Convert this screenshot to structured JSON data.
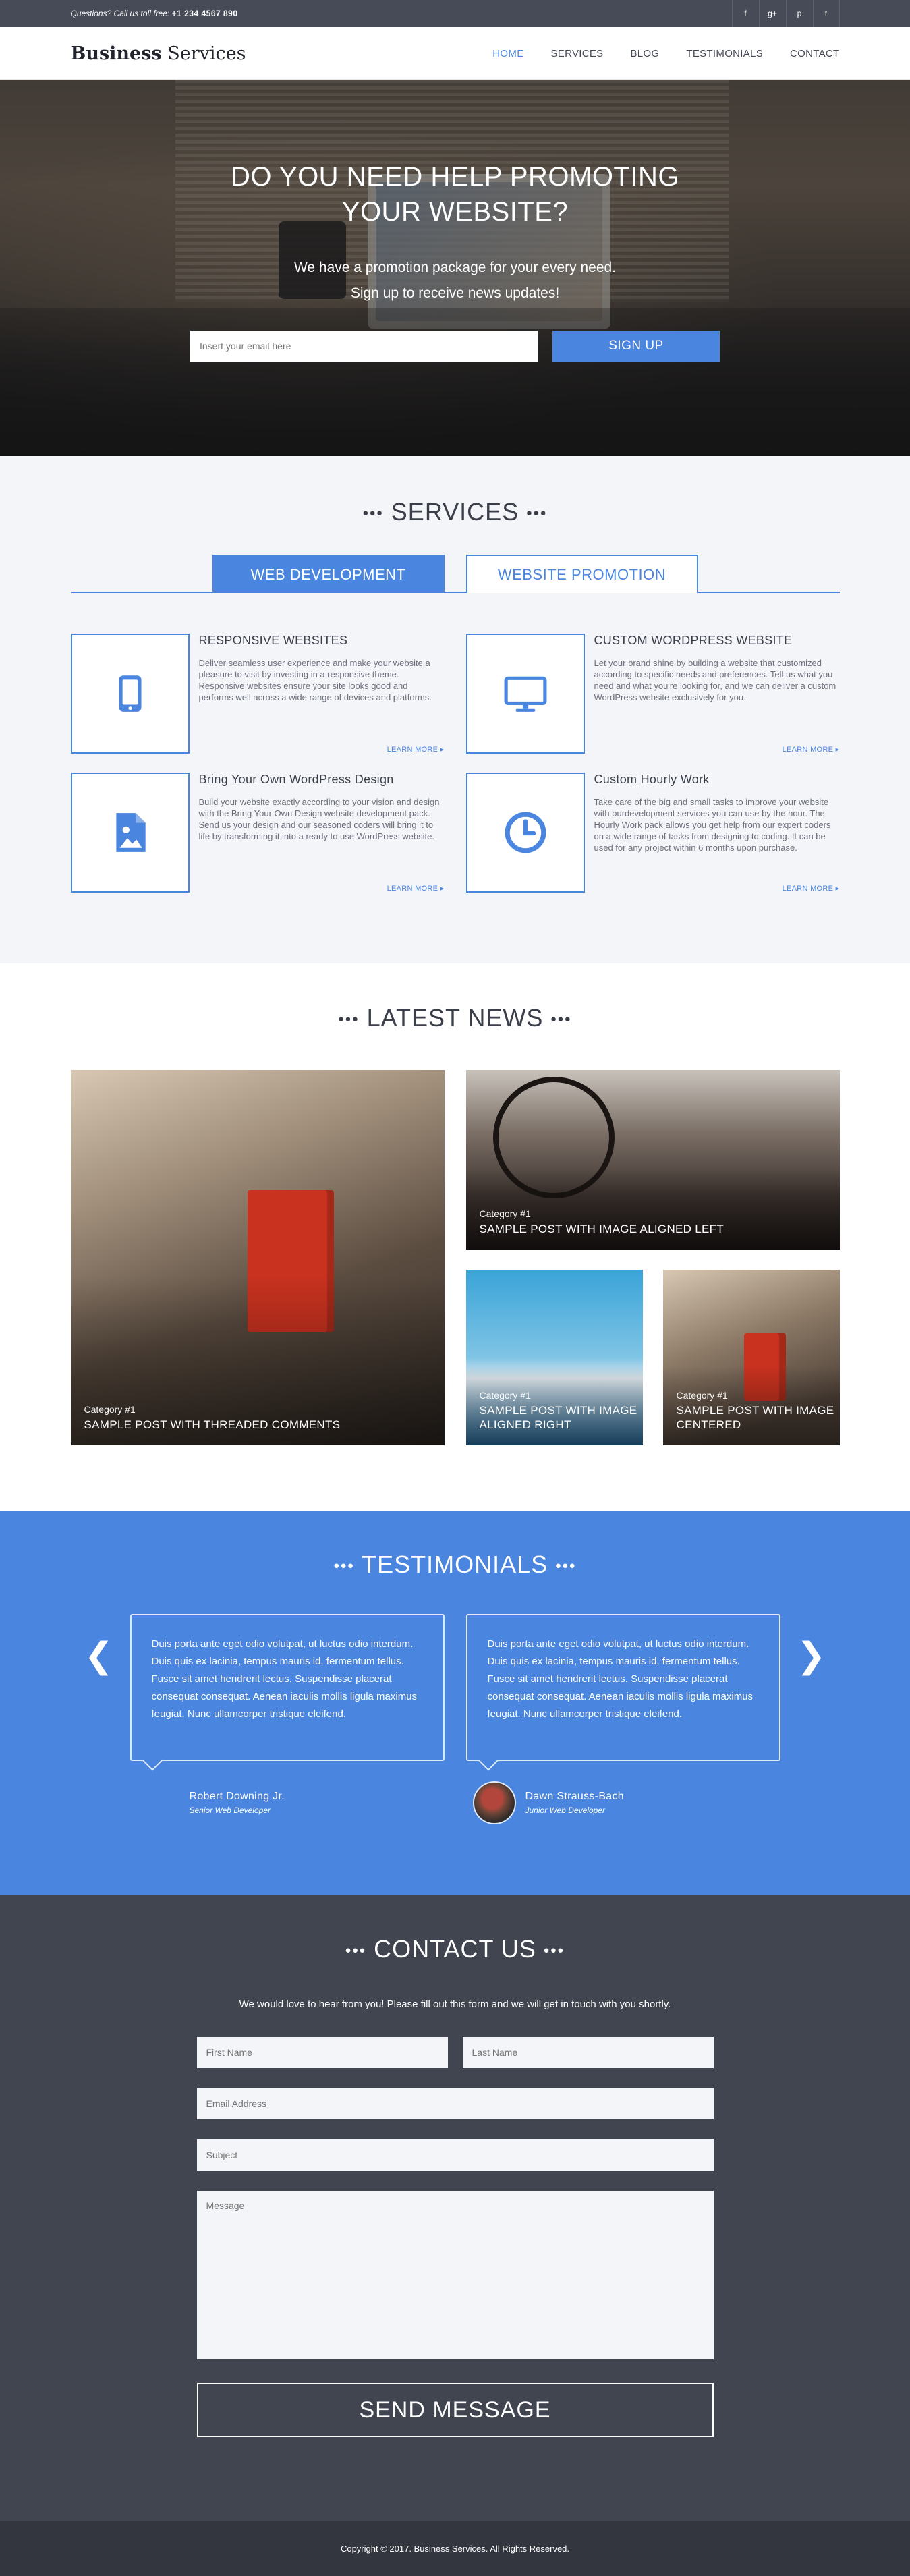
{
  "topbar": {
    "phone_label": "Questions? Call us toll free:",
    "phone_number": "+1 234 4567 890",
    "social": [
      "f",
      "g+",
      "p",
      "t"
    ]
  },
  "nav": {
    "logo_bold": "Business",
    "logo_rest": "Services",
    "items": [
      "HOME",
      "SERVICES",
      "BLOG",
      "TESTIMONIALS",
      "CONTACT"
    ]
  },
  "hero": {
    "title_line1": "DO YOU NEED HELP PROMOTING",
    "title_line2": "YOUR WEBSITE?",
    "sub_line1": "We have a promotion package for your every need.",
    "sub_line2": "Sign up to receive news updates!",
    "email_placeholder": "Insert your email here",
    "signup_label": "SIGN UP"
  },
  "services": {
    "title": "SERVICES",
    "tabs": [
      "WEB DEVELOPMENT",
      "WEBSITE PROMOTION"
    ],
    "items": [
      {
        "icon": "tablet-icon",
        "title": "RESPONSIVE WEBSITES",
        "text": "Deliver seamless user experience and make your website a pleasure to visit by investing in a responsive theme. Responsive websites ensure your site looks good and performs well across a wide range of devices and platforms.",
        "more": "LEARN MORE"
      },
      {
        "icon": "monitor-icon",
        "title": "CUSTOM WORDPRESS WEBSITE",
        "text": "Let your brand shine by building a website that customized according to specific needs and preferences. Tell us what you need and what you're looking for, and we can deliver a custom WordPress website exclusively for you.",
        "more": "LEARN MORE"
      },
      {
        "icon": "image-file-icon",
        "title": "Bring Your Own WordPress Design",
        "text": "Build your website exactly according to your vision and design with the Bring Your Own Design website development pack. Send us your design and our seasoned coders will bring it to life by transforming it into a ready to use WordPress website.",
        "more": "LEARN MORE"
      },
      {
        "icon": "clock-icon",
        "title": "Custom Hourly Work",
        "text": "Take care of the big and small tasks to improve your website with ourdevelopment services you can use by the hour. The Hourly Work pack allows you get help from our expert coders on a wide range of tasks from designing to coding. It can be used for any project within 6 months upon purchase.",
        "more": "LEARN MORE"
      }
    ]
  },
  "news": {
    "title": "LATEST NEWS",
    "posts": [
      {
        "category": "Category #1",
        "title": "SAMPLE POST WITH THREADED COMMENTS"
      },
      {
        "category": "Category #1",
        "title": "SAMPLE POST WITH IMAGE ALIGNED LEFT"
      },
      {
        "category": "Category #1",
        "title": "SAMPLE POST WITH IMAGE ALIGNED RIGHT"
      },
      {
        "category": "Category #1",
        "title": "SAMPLE POST WITH IMAGE CENTERED"
      }
    ]
  },
  "testimonials": {
    "title": "TESTIMONIALS",
    "items": [
      {
        "quote": "Duis porta ante eget odio volutpat, ut luctus odio interdum. Duis quis ex lacinia, tempus mauris id, fermentum tellus. Fusce sit amet hendrerit lectus. Suspendisse placerat consequat consequat. Aenean iaculis mollis ligula maximus feugiat. Nunc ullamcorper tristique eleifend.",
        "name": "Robert Downing Jr.",
        "role": "Senior Web Developer"
      },
      {
        "quote": "Duis porta ante eget odio volutpat, ut luctus odio interdum. Duis quis ex lacinia, tempus mauris id, fermentum tellus. Fusce sit amet hendrerit lectus. Suspendisse placerat consequat consequat. Aenean iaculis mollis ligula maximus feugiat. Nunc ullamcorper tristique eleifend.",
        "name": "Dawn Strauss-Bach",
        "role": "Junior Web Developer"
      }
    ]
  },
  "contact": {
    "title": "CONTACT US",
    "intro": "We would love to hear from you! Please fill out this form and we will get in touch with you shortly.",
    "first_name": "First Name",
    "last_name": "Last Name",
    "email": "Email Address",
    "subject": "Subject",
    "message": "Message",
    "send_label": "SEND MESSAGE"
  },
  "footer": {
    "copyright": "Copyright © 2017. Business Services. All Rights Reserved."
  },
  "colors": {
    "accent": "#4a86df",
    "dark": "#414550",
    "topbar": "#474b58",
    "light_bg": "#f4f5f9"
  }
}
